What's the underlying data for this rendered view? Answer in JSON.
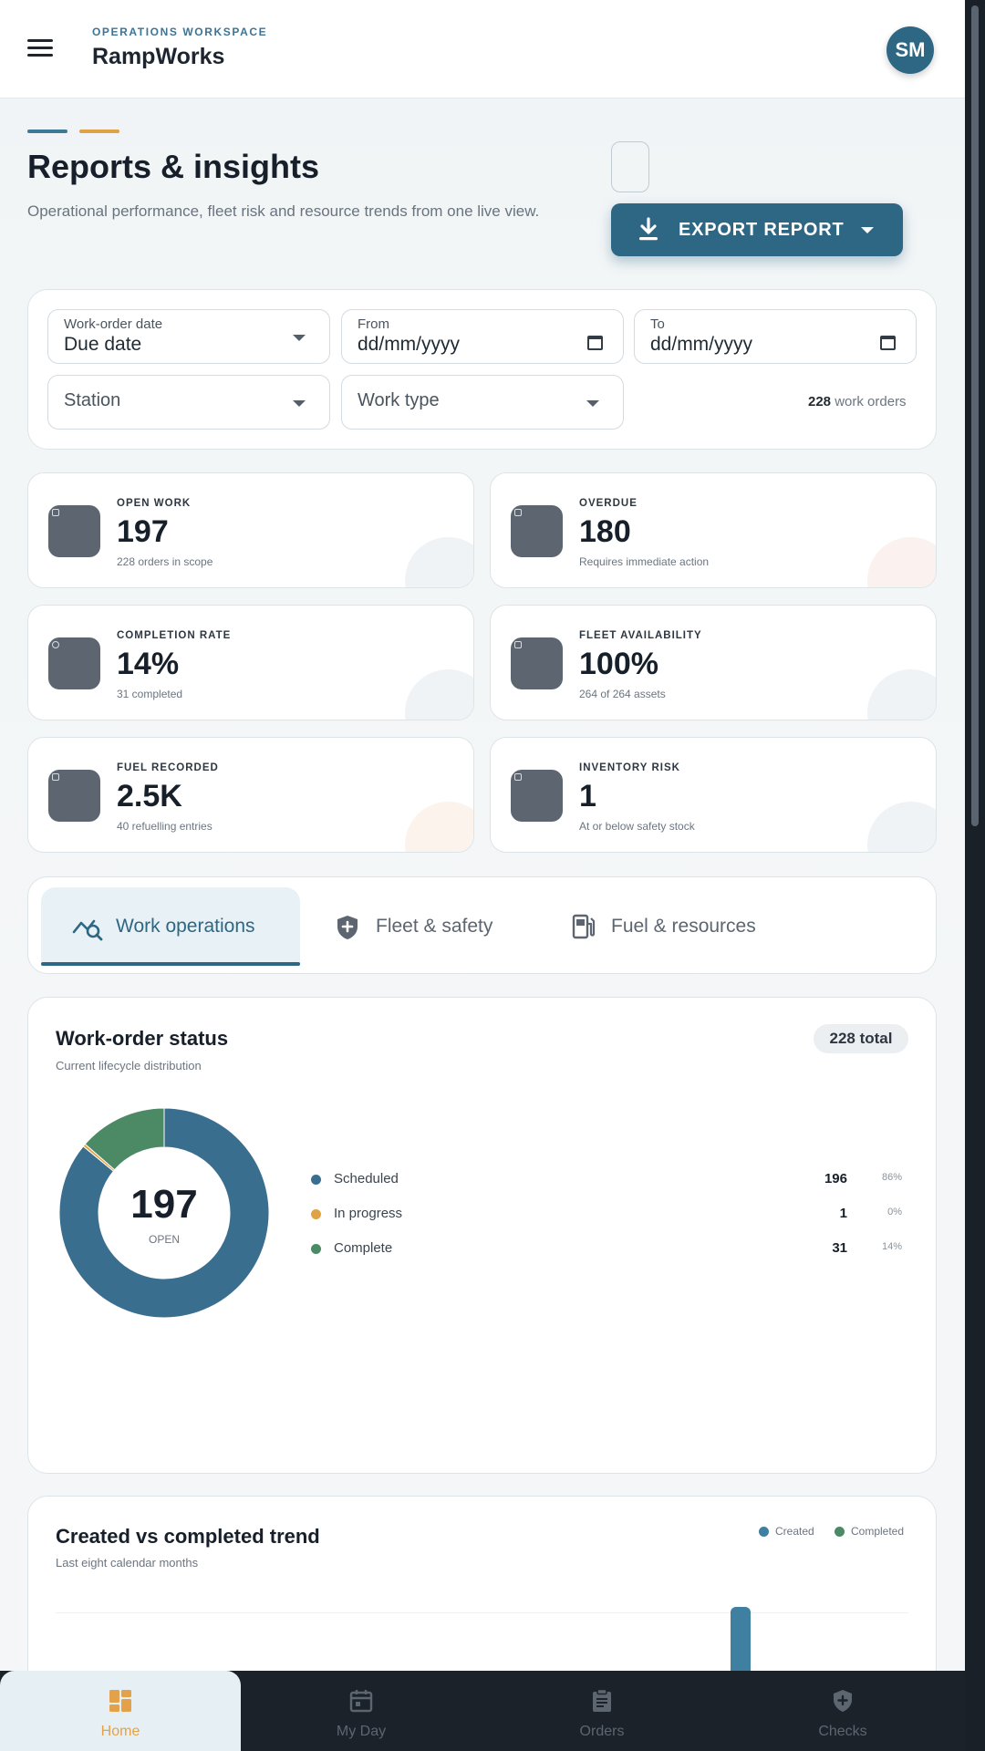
{
  "header": {
    "workspace_label": "OPERATIONS WORKSPACE",
    "app_name": "RampWorks",
    "avatar_initials": "SM"
  },
  "page": {
    "title": "Reports & insights",
    "subtitle": "Operational performance, fleet risk and resource trends from one live view.",
    "export_label": "EXPORT REPORT"
  },
  "filters": {
    "date_field": {
      "label": "Work-order date",
      "value": "Due date"
    },
    "from": {
      "label": "From",
      "value": "dd/mm/yyyy"
    },
    "to": {
      "label": "To",
      "value": "dd/mm/yyyy"
    },
    "station": {
      "placeholder": "Station"
    },
    "work_type": {
      "placeholder": "Work type"
    },
    "count_value": "228",
    "count_suffix": "work orders"
  },
  "kpis": [
    {
      "label": "OPEN WORK",
      "value": "197",
      "sub": "228 orders in scope",
      "icon": "clipboard-icon"
    },
    {
      "label": "OVERDUE",
      "value": "180",
      "sub": "Requires immediate action",
      "icon": "warning-icon"
    },
    {
      "label": "COMPLETION RATE",
      "value": "14%",
      "sub": "31 completed",
      "icon": "check-circle-icon"
    },
    {
      "label": "FLEET AVAILABILITY",
      "value": "100%",
      "sub": "264 of 264 assets",
      "icon": "truck-icon"
    },
    {
      "label": "FUEL RECORDED",
      "value": "2.5K",
      "sub": "40 refuelling entries",
      "icon": "fuel-icon"
    },
    {
      "label": "INVENTORY RISK",
      "value": "1",
      "sub": "At or below safety stock",
      "icon": "box-icon"
    }
  ],
  "tabs": [
    {
      "label": "Work operations",
      "icon": "analytics-icon",
      "active": true
    },
    {
      "label": "Fleet & safety",
      "icon": "shield-icon",
      "active": false
    },
    {
      "label": "Fuel & resources",
      "icon": "fuel-pump-icon",
      "active": false
    }
  ],
  "status_card": {
    "title": "Work-order status",
    "subtitle": "Current lifecycle distribution",
    "total_badge": "228 total",
    "center_value": "197",
    "center_label": "OPEN"
  },
  "chart_data": [
    {
      "type": "pie",
      "title": "Work-order status",
      "categories": [
        "Scheduled",
        "In progress",
        "Complete"
      ],
      "values": [
        196,
        1,
        31
      ],
      "percentages": [
        "86%",
        "0%",
        "14%"
      ],
      "colors": [
        "#3a6e8f",
        "#e0a246",
        "#4b8a65"
      ],
      "legend": "right"
    },
    {
      "type": "bar",
      "title": "Created vs completed trend",
      "subtitle": "Last eight calendar months",
      "series": [
        {
          "name": "Created",
          "color": "#3f7f9f"
        },
        {
          "name": "Completed",
          "color": "#4b8a65"
        }
      ],
      "legend": "top-right"
    }
  ],
  "trend_card": {
    "title": "Created vs completed trend",
    "subtitle": "Last eight calendar months",
    "legend": [
      "Created",
      "Completed"
    ]
  },
  "bottom_nav": [
    {
      "label": "Home",
      "active": true
    },
    {
      "label": "My Day",
      "active": false
    },
    {
      "label": "Orders",
      "active": false
    },
    {
      "label": "Checks",
      "active": false
    }
  ]
}
